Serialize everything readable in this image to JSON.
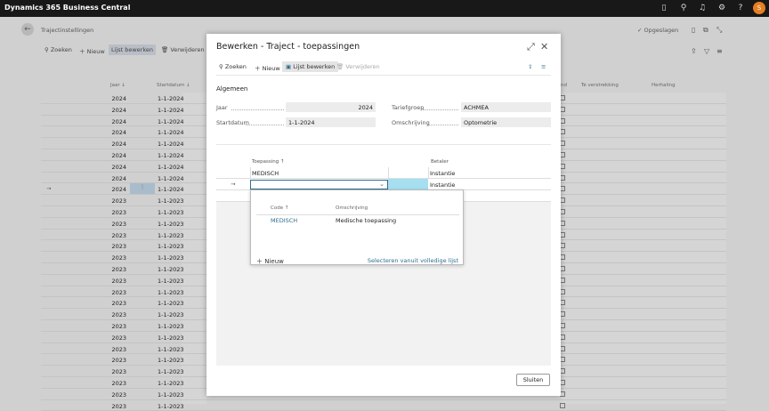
{
  "app": {
    "title": "Dynamics 365 Business Central",
    "avatar": "S"
  },
  "background": {
    "page_title": "Trajectinstellingen",
    "saved": "✓ Opgeslagen",
    "actions": [
      "⚲ Zoeken",
      "＋ Nieuw",
      "Lijst bewerken",
      "🗑 Verwijderen"
    ],
    "columns": [
      "Jaar ↓",
      "Startdatum ↓",
      "nd",
      "Te verstrekking",
      "Herhaling"
    ],
    "rows": [
      {
        "jaar": "2024",
        "datum": "1-1-2024"
      },
      {
        "jaar": "2024",
        "datum": "1-1-2024"
      },
      {
        "jaar": "2024",
        "datum": "1-1-2024"
      },
      {
        "jaar": "2024",
        "datum": "1-1-2024"
      },
      {
        "jaar": "2024",
        "datum": "1-1-2024"
      },
      {
        "jaar": "2024",
        "datum": "1-1-2024"
      },
      {
        "jaar": "2024",
        "datum": "1-1-2024"
      },
      {
        "jaar": "2024",
        "datum": "1-1-2024"
      },
      {
        "jaar": "2024",
        "datum": "1-1-2024"
      },
      {
        "jaar": "2023",
        "datum": "1-1-2023"
      },
      {
        "jaar": "2023",
        "datum": "1-1-2023"
      },
      {
        "jaar": "2023",
        "datum": "1-1-2023"
      },
      {
        "jaar": "2023",
        "datum": "1-1-2023"
      },
      {
        "jaar": "2023",
        "datum": "1-1-2023"
      },
      {
        "jaar": "2023",
        "datum": "1-1-2023"
      },
      {
        "jaar": "2023",
        "datum": "1-1-2023"
      },
      {
        "jaar": "2023",
        "datum": "1-1-2023"
      },
      {
        "jaar": "2023",
        "datum": "1-1-2023"
      },
      {
        "jaar": "2023",
        "datum": "1-1-2023"
      },
      {
        "jaar": "2023",
        "datum": "1-1-2023"
      },
      {
        "jaar": "2023",
        "datum": "1-1-2023"
      },
      {
        "jaar": "2023",
        "datum": "1-1-2023"
      },
      {
        "jaar": "2023",
        "datum": "1-1-2023"
      },
      {
        "jaar": "2023",
        "datum": "1-1-2023"
      },
      {
        "jaar": "2023",
        "datum": "1-1-2023"
      },
      {
        "jaar": "2023",
        "datum": "1-1-2023"
      },
      {
        "jaar": "2023",
        "datum": "1-1-2023"
      },
      {
        "jaar": "2023",
        "datum": "1-1-2023"
      }
    ]
  },
  "dialog": {
    "title": "Bewerken - Traject - toepassingen",
    "toolbar": {
      "search": "Zoeken",
      "new": "Nieuw",
      "edit_list": "Lijst bewerken",
      "delete": "Verwijderen"
    },
    "section": "Algemeen",
    "fields": {
      "jaar_label": "Jaar",
      "jaar_value": "2024",
      "start_label": "Startdatum",
      "start_value": "1-1-2024",
      "tarief_label": "Tariefgroep",
      "tarief_value": "ACHMEA",
      "omschr_label": "Omschrijving",
      "omschr_value": "Optometrie"
    },
    "lines": {
      "col_toepassing": "Toepassing ↑",
      "col_betaler": "Betaler",
      "rows": [
        {
          "toepassing": "MEDISCH",
          "betaler": "Instantie"
        },
        {
          "toepassing": "",
          "betaler": "Instantie"
        }
      ]
    },
    "dropdown": {
      "col_code": "Code ↑",
      "col_omschr": "Omschrijving",
      "code": "MEDISCH",
      "omschr": "Medische toepassing",
      "new": "Nieuw",
      "select_full": "Selecteren vanuit volledige lijst"
    },
    "close": "Sluiten"
  }
}
